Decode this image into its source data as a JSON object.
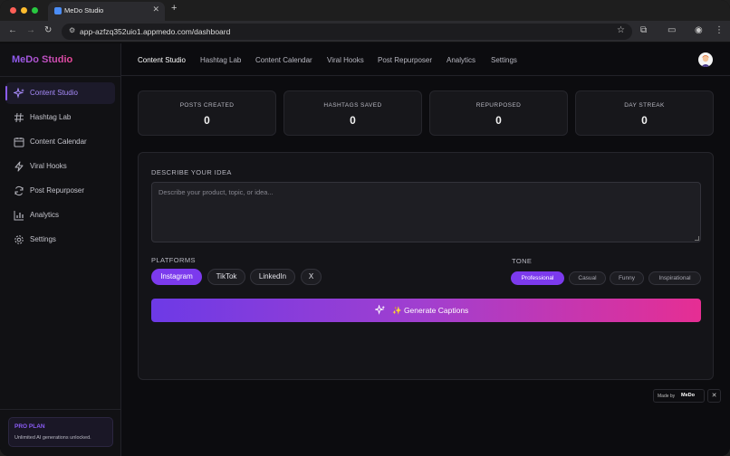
{
  "browser": {
    "tab_title": "MeDo Studio",
    "url": "app-azfzq352uio1.appmedo.com/dashboard"
  },
  "sidebar": {
    "brand": "MeDo Studio",
    "items": [
      {
        "label": "Content Studio",
        "icon": "sparkle-icon",
        "active": true
      },
      {
        "label": "Hashtag Lab",
        "icon": "hash-icon"
      },
      {
        "label": "Content Calendar",
        "icon": "calendar-icon"
      },
      {
        "label": "Viral Hooks",
        "icon": "lightning-icon"
      },
      {
        "label": "Post Repurposer",
        "icon": "refresh-icon"
      },
      {
        "label": "Analytics",
        "icon": "bar-chart-icon"
      },
      {
        "label": "Settings",
        "icon": "gear-icon"
      }
    ],
    "plan": {
      "title": "PRO PLAN",
      "subtitle": "Unlimited AI generations unlocked."
    }
  },
  "topnav": {
    "items": [
      "Content Studio",
      "Hashtag Lab",
      "Content Calendar",
      "Viral Hooks",
      "Post Repurposer",
      "Analytics",
      "Settings"
    ],
    "active": "Content Studio"
  },
  "stats": [
    {
      "label": "POSTS CREATED",
      "value": "0"
    },
    {
      "label": "HASHTAGS SAVED",
      "value": "0"
    },
    {
      "label": "REPURPOSED",
      "value": "0"
    },
    {
      "label": "DAY STREAK",
      "value": "0"
    }
  ],
  "composer": {
    "idea_label": "DESCRIBE YOUR IDEA",
    "idea_placeholder": "Describe your product, topic, or idea...",
    "platforms_label": "PLATFORMS",
    "platforms": [
      "Instagram",
      "TikTok",
      "LinkedIn",
      "X"
    ],
    "platform_selected": "Instagram",
    "tone_label": "TONE",
    "tones": [
      "Professional",
      "Casual",
      "Funny",
      "Inspirational"
    ],
    "tone_selected": "Professional",
    "generate_label": "✨ Generate Captions"
  },
  "badge": {
    "text": "Made by",
    "brand": "MeDo",
    "close": "✕"
  },
  "colors": {
    "accent": "#8b5cf6",
    "gradient_start": "#6d3ae6",
    "gradient_end": "#e62e93"
  }
}
